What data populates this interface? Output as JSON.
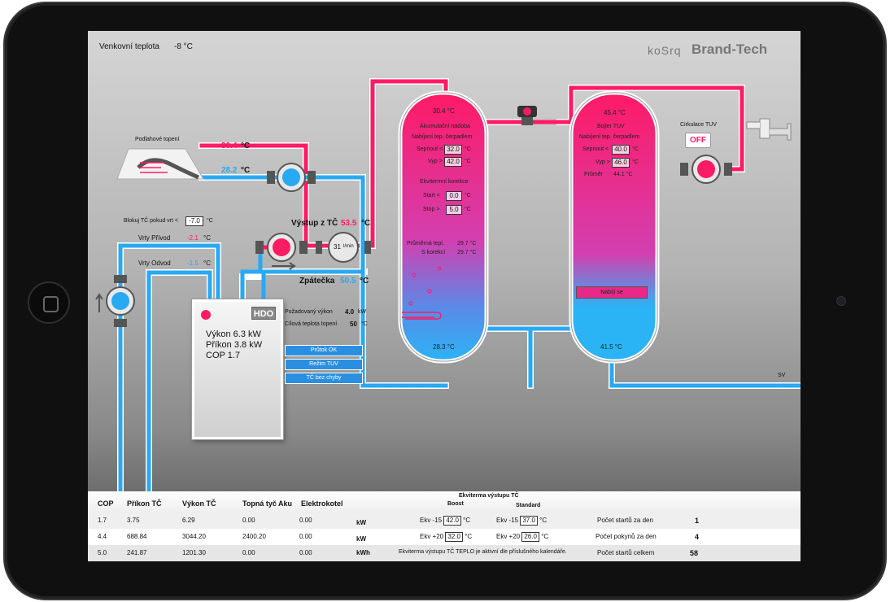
{
  "header": {
    "outdoor_label": "Venkovní teplota",
    "outdoor_value": "-8 °C",
    "logo_korg": "koSrq",
    "logo_brand": "Brand-Tech"
  },
  "floor_heating": {
    "label": "Podlahové topení",
    "supply_temp": "30.4",
    "return_temp": "28.2",
    "unit": "°C"
  },
  "boreholes": {
    "block_label": "Blokuj TČ pokud vrt <",
    "block_value": "-7.0",
    "block_unit": "°C",
    "supply_label": "Vrty Přívod",
    "supply_value": "-2.1",
    "return_label": "Vrty Odvod",
    "return_value": "-1.5",
    "unit": "°C"
  },
  "heatpump_circuit": {
    "output_label": "Výstup z TČ",
    "output_value": "53.5",
    "return_label": "Zpátečka",
    "return_value": "50.5",
    "unit": "°C",
    "flow_value": "31",
    "flow_unit": "l/min"
  },
  "heatpump": {
    "badge": "HDO",
    "power_label": "Výkon",
    "power_value": "6.3",
    "power_unit": "kW",
    "input_label": "Příkon",
    "input_value": "3.8",
    "input_unit": "kW",
    "cop_label": "COP",
    "cop_value": "1.7",
    "requested_label": "Požadovaný výkon",
    "requested_value": "4.0",
    "requested_unit": "kW",
    "target_label": "Cílová teplota topení",
    "target_value": "50",
    "target_unit": "°C",
    "status_buttons": [
      "Průtok OK",
      "Režim TUV",
      "TČ bez chyby"
    ]
  },
  "accumulation_tank": {
    "top_temp": "30.4 °C",
    "title": "Akumulační nádoba",
    "charge_label": "Nabíjení tep. čerpadlem",
    "on_label": "Sepnout <",
    "on_value": "32.0",
    "off_label": "Vyp >",
    "off_value": "42.0",
    "unit": "°C",
    "equitherm_title": "Ekvitermní korekce",
    "eq_start_label": "Start <",
    "eq_start_value": "0.0",
    "eq_stop_label": "Stop >",
    "eq_stop_value": "5.0",
    "avg_label": "Průměrná tepl.",
    "avg_value": "29.7 °C",
    "corr_label": "S korekcí",
    "corr_value": "29.7 °C",
    "bottom_temp": "28.3 °C"
  },
  "boiler": {
    "top_temp": "45.4 °C",
    "title": "Bojler TUV",
    "charge_label": "Nabíjení tep. čerpadlem",
    "on_label": "Sepnout <",
    "on_value": "40.0",
    "off_label": "Vyp >",
    "off_value": "46.0",
    "unit": "°C",
    "avg_label": "Průměr",
    "avg_value": "44.1 °C",
    "charging_label": "Nabíjí se",
    "bottom_temp": "41.5 °C"
  },
  "circulation": {
    "label": "Cirkulace TUV",
    "button": "OFF"
  },
  "sv_label": "SV",
  "table": {
    "headers": [
      "COP",
      "Příkon TČ",
      "Výkon TČ",
      "Topná tyč Aku",
      "Elektrokotel"
    ],
    "eq_header": "Ekviterma výstupu TČ",
    "boost_header": "Boost",
    "standard_header": "Standard",
    "rows": [
      {
        "cop": "1.7",
        "input": "3.75",
        "power": "6.29",
        "rod": "0.00",
        "boiler": "0.00",
        "unit": "kW",
        "b_label": "Ekv -15",
        "b_value": "42.0",
        "s_label": "Ekv -15",
        "s_value": "37.0",
        "deg": "°C",
        "stat_label": "Počet startů za den",
        "stat_value": "1"
      },
      {
        "cop": "4.4",
        "input": "688.84",
        "power": "3044.20",
        "rod": "2400.20",
        "boiler": "0.00",
        "unit": "kW",
        "b_label": "Ekv +20",
        "b_value": "32.0",
        "s_label": "Ekv +20",
        "s_value": "26.0",
        "deg": "°C",
        "stat_label": "Počet pokynů za den",
        "stat_value": "4"
      },
      {
        "cop": "5.0",
        "input": "241.87",
        "power": "1201.30",
        "rod": "0.00",
        "boiler": "0.00",
        "unit": "kWh",
        "note": "Ekviterma výstupu TČ TEPLO je aktivní dle příslušného kalendáře.",
        "stat_label": "Počet startů celkem",
        "stat_value": "58"
      }
    ]
  },
  "colors": {
    "hot": "#ff1a66",
    "cold": "#28a9f2",
    "button": "#2a8fe0"
  }
}
